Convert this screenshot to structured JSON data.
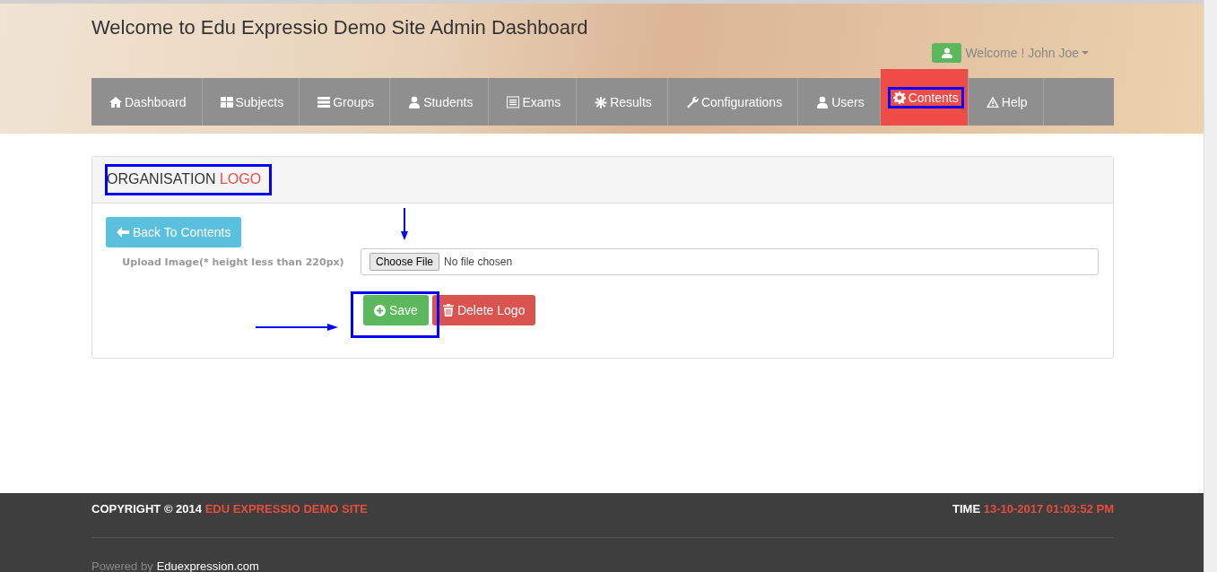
{
  "header": {
    "title": "Welcome to Edu Expressio Demo Site Admin Dashboard",
    "user_menu": "Welcome ! John Joe"
  },
  "nav": [
    {
      "label": "Dashboard",
      "selected": false
    },
    {
      "label": "Subjects",
      "selected": false
    },
    {
      "label": "Groups",
      "selected": false
    },
    {
      "label": "Students",
      "selected": false
    },
    {
      "label": "Exams",
      "selected": false
    },
    {
      "label": "Results",
      "selected": false
    },
    {
      "label": "Configurations",
      "selected": false
    },
    {
      "label": "Users",
      "selected": false
    },
    {
      "label": "Contents",
      "selected": true
    },
    {
      "label": "Help",
      "selected": false
    }
  ],
  "panel": {
    "title": "ORGANISATION",
    "title_accent": "LOGO",
    "back_button": "Back To Contents",
    "upload_label": "Upload Image(* height less than 220px)",
    "file_button": "Choose File",
    "file_status": "No file chosen",
    "save_button": "Save",
    "delete_button": "Delete Logo"
  },
  "footer": {
    "copyright": "COPYRIGHT © 2014",
    "site_name": "EDU EXPRESSIO DEMO SITE",
    "time_label": "TIME",
    "time_value": "13-10-2017 01:03:52 PM",
    "powered_by": "Powered by",
    "powered_link": "Eduexpression.com"
  }
}
